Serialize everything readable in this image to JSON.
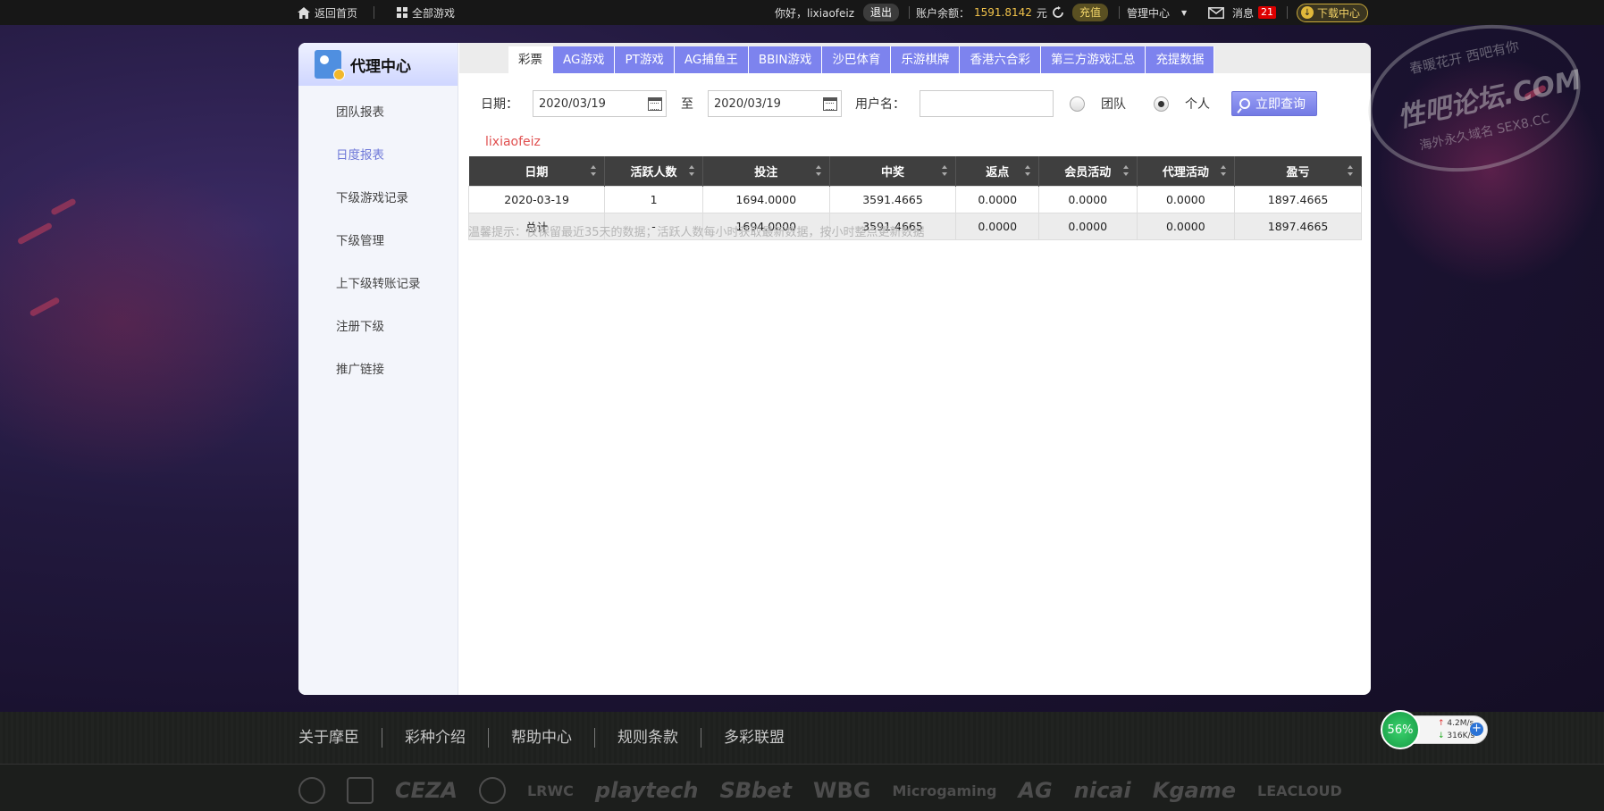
{
  "topbar": {
    "home": "返回首页",
    "all_games": "全部游戏",
    "greeting": "你好，lixiaofeiz",
    "logout": "退出",
    "balance_label": "账户余额：",
    "balance_value": "1591.8142",
    "balance_unit": "元",
    "recharge": "充值",
    "manage": "管理中心",
    "messages": "消息",
    "message_count": "21",
    "download": "下载中心"
  },
  "sidebar": {
    "title": "代理中心",
    "items": [
      {
        "label": "团队报表"
      },
      {
        "label": "日度报表"
      },
      {
        "label": "下级游戏记录"
      },
      {
        "label": "下级管理"
      },
      {
        "label": "上下级转账记录"
      },
      {
        "label": "注册下级"
      },
      {
        "label": "推广链接"
      }
    ]
  },
  "tabs": [
    "彩票",
    "AG游戏",
    "PT游戏",
    "AG捕鱼王",
    "BBIN游戏",
    "沙巴体育",
    "乐游棋牌",
    "香港六合彩",
    "第三方游戏汇总",
    "充提数据"
  ],
  "filter": {
    "date_label": "日期：",
    "start_date": "2020/03/19",
    "to_label": "至",
    "end_date": "2020/03/19",
    "username_label": "用户名：",
    "username_value": "",
    "radio_team": "团队",
    "radio_personal": "个人",
    "search_button": "立即查询"
  },
  "report": {
    "username": "lixiaofeiz",
    "columns": [
      "日期",
      "活跃人数",
      "投注",
      "中奖",
      "返点",
      "会员活动",
      "代理活动",
      "盈亏"
    ],
    "rows": [
      [
        "2020-03-19",
        "1",
        "1694.0000",
        "3591.4665",
        "0.0000",
        "0.0000",
        "0.0000",
        "1897.4665"
      ]
    ],
    "total": [
      "总计",
      "-",
      "1694.0000",
      "3591.4665",
      "0.0000",
      "0.0000",
      "0.0000",
      "1897.4665"
    ],
    "hint": "温馨提示：仅保留最近35天的数据；活跃人数每小时获取最新数据，按小时整点更新数据"
  },
  "footer": {
    "links": [
      "关于摩臣",
      "彩种介绍",
      "帮助中心",
      "规则条款",
      "多彩联盟"
    ],
    "logos": [
      "CEZA",
      "LRWC",
      "playtech",
      "SBbet",
      "WBG",
      "Microgaming",
      "AG",
      "nicai",
      "Kgame",
      "LEACLOUD"
    ]
  },
  "watermark": {
    "top": "春暖花开 西吧有你",
    "main": "性吧论坛.COM",
    "bottom": "海外永久域名 SEX8.CC"
  },
  "speed_widget": {
    "percent": "56%",
    "up": "4.2M/s",
    "down": "316K/s"
  },
  "colors": {
    "accent_tab": "#7d83ee",
    "active_sidebar": "#6e78d8",
    "username_red": "#e04f4f",
    "balance_gold": "#f0c24a"
  }
}
